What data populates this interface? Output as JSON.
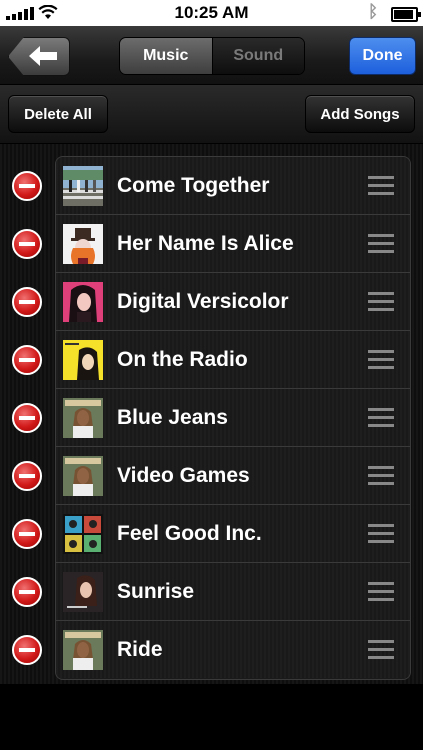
{
  "status_bar": {
    "time": "10:25 AM"
  },
  "nav": {
    "back_icon": "back-arrow-icon",
    "segments": [
      "Music",
      "Sound"
    ],
    "selected_segment": "Music",
    "done_label": "Done"
  },
  "toolbar": {
    "delete_all_label": "Delete All",
    "add_songs_label": "Add Songs"
  },
  "songs": [
    {
      "title": "Come Together",
      "art": "abbey-road-cover"
    },
    {
      "title": "Her Name Is Alice",
      "art": "mad-hatter-cover"
    },
    {
      "title": "Digital Versicolor",
      "art": "glass-candy-cover"
    },
    {
      "title": "On the Radio",
      "art": "regina-spektor-cover"
    },
    {
      "title": "Blue Jeans",
      "art": "born-to-die-cover"
    },
    {
      "title": "Video Games",
      "art": "born-to-die-cover"
    },
    {
      "title": "Feel Good Inc.",
      "art": "demon-days-cover"
    },
    {
      "title": "Sunrise",
      "art": "norah-jones-cover"
    },
    {
      "title": "Ride",
      "art": "paradise-cover"
    }
  ],
  "colors": {
    "done_blue": "#1d5fdc",
    "delete_red": "#d21a1a"
  }
}
